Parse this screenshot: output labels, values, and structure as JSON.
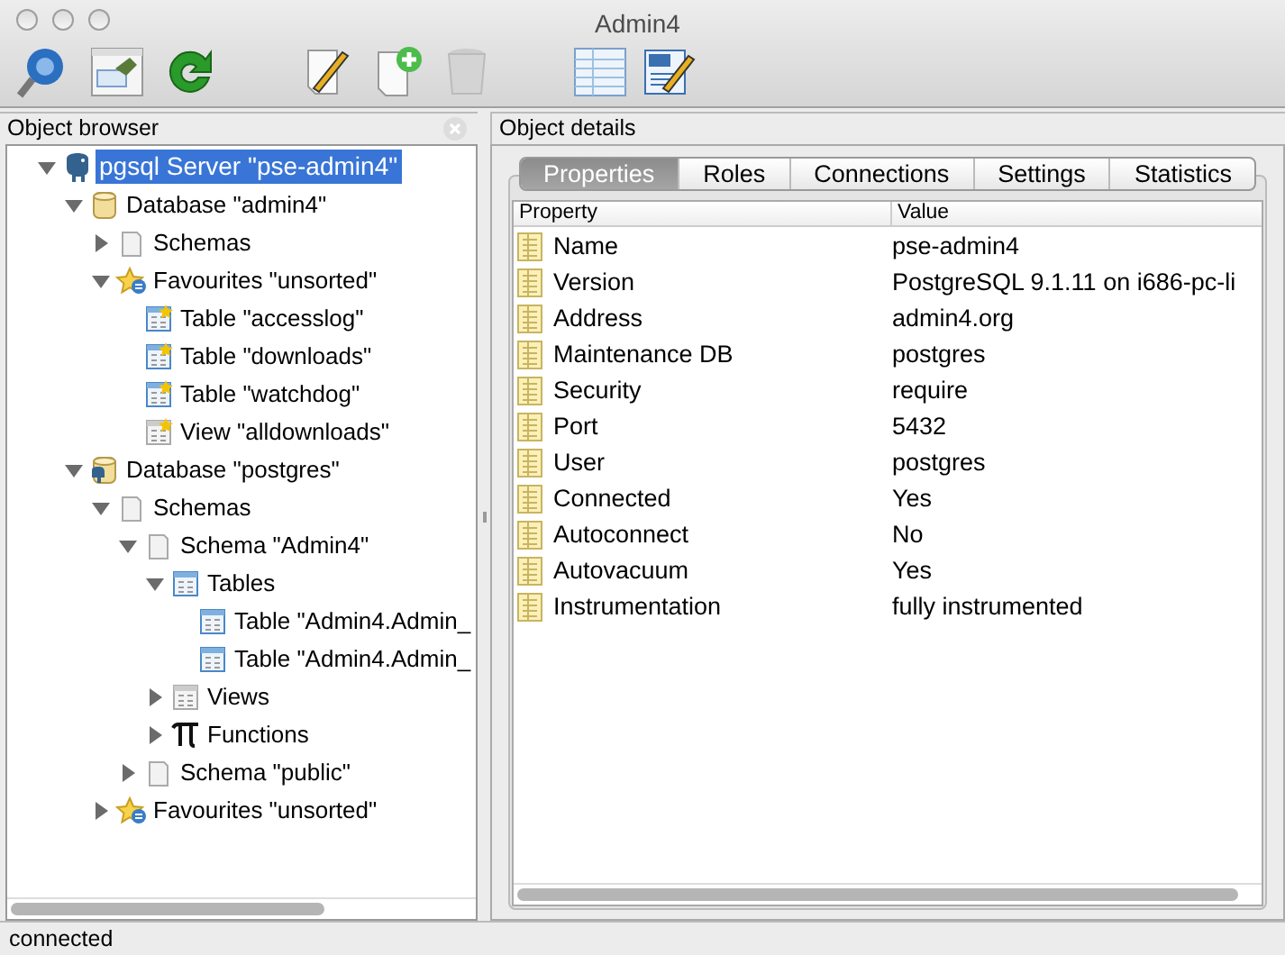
{
  "window": {
    "title": "Admin4"
  },
  "object_browser": {
    "title": "Object browser",
    "tree": [
      {
        "label": "pgsql Server \"pse-admin4\"",
        "kind": "server",
        "expanded": true,
        "selected": true,
        "children": [
          {
            "label": "Database \"admin4\"",
            "kind": "database",
            "expanded": true,
            "selected": false,
            "children": [
              {
                "label": "Schemas",
                "kind": "folder",
                "expanded": false,
                "selected": false
              },
              {
                "label": "Favourites \"unsorted\"",
                "kind": "favourites",
                "expanded": true,
                "selected": false,
                "children": [
                  {
                    "label": "Table \"accesslog\"",
                    "kind": "fav-table",
                    "selected": false
                  },
                  {
                    "label": "Table \"downloads\"",
                    "kind": "fav-table",
                    "selected": false
                  },
                  {
                    "label": "Table \"watchdog\"",
                    "kind": "fav-table",
                    "selected": false
                  },
                  {
                    "label": "View \"alldownloads\"",
                    "kind": "fav-view",
                    "selected": false
                  }
                ]
              }
            ]
          },
          {
            "label": "Database \"postgres\"",
            "kind": "database-elephant",
            "expanded": true,
            "selected": false,
            "children": [
              {
                "label": "Schemas",
                "kind": "folder",
                "expanded": true,
                "selected": false,
                "children": [
                  {
                    "label": "Schema \"Admin4\"",
                    "kind": "folder",
                    "expanded": true,
                    "selected": false,
                    "children": [
                      {
                        "label": "Tables",
                        "kind": "table",
                        "expanded": true,
                        "selected": false,
                        "children": [
                          {
                            "label": "Table \"Admin4.Admin_",
                            "kind": "table",
                            "selected": false
                          },
                          {
                            "label": "Table \"Admin4.Admin_",
                            "kind": "table",
                            "selected": false
                          }
                        ]
                      },
                      {
                        "label": "Views",
                        "kind": "view",
                        "expanded": false,
                        "selected": false
                      },
                      {
                        "label": "Functions",
                        "kind": "functions",
                        "expanded": false,
                        "selected": false
                      }
                    ]
                  },
                  {
                    "label": "Schema \"public\"",
                    "kind": "folder",
                    "expanded": false,
                    "selected": false
                  }
                ]
              },
              {
                "label": "Favourites \"unsorted\"",
                "kind": "favourites",
                "expanded": false,
                "selected": false
              }
            ]
          }
        ]
      }
    ]
  },
  "object_details": {
    "title": "Object details",
    "tabs": [
      {
        "label": "Properties",
        "selected": true
      },
      {
        "label": "Roles",
        "selected": false
      },
      {
        "label": "Connections",
        "selected": false
      },
      {
        "label": "Settings",
        "selected": false
      },
      {
        "label": "Statistics",
        "selected": false
      }
    ],
    "table": {
      "columns": [
        "Property",
        "Value"
      ],
      "rows": [
        {
          "property": "Name",
          "value": "pse-admin4"
        },
        {
          "property": "Version",
          "value": "PostgreSQL 9.1.11 on i686-pc-li"
        },
        {
          "property": "Address",
          "value": "admin4.org"
        },
        {
          "property": "Maintenance DB",
          "value": "postgres"
        },
        {
          "property": "Security",
          "value": "require"
        },
        {
          "property": "Port",
          "value": "5432"
        },
        {
          "property": "User",
          "value": "postgres"
        },
        {
          "property": "Connected",
          "value": "Yes"
        },
        {
          "property": "Autoconnect",
          "value": "No"
        },
        {
          "property": "Autovacuum",
          "value": "Yes"
        },
        {
          "property": "Instrumentation",
          "value": "fully instrumented"
        }
      ]
    }
  },
  "status_bar": "connected"
}
